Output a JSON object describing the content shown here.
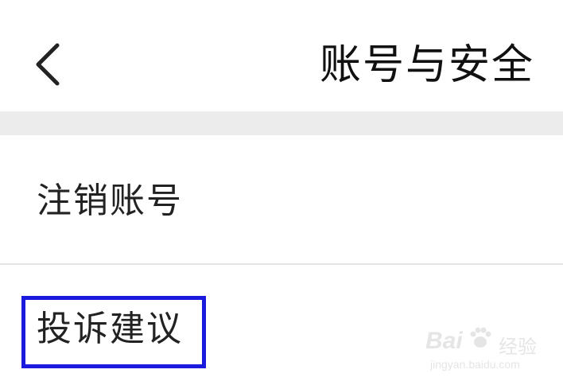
{
  "header": {
    "back_icon": "chevron-left-icon",
    "title": "账号与安全"
  },
  "menu": {
    "items": [
      {
        "label": "注销账号"
      },
      {
        "label": "投诉建议",
        "highlighted": true
      }
    ]
  },
  "annotation": {
    "highlight_color": "#1a1adf"
  },
  "watermark": {
    "logo_text": "Bai",
    "logo_text_tail": "",
    "brand_cn": "经验",
    "url": "jingyan.baidu.com"
  }
}
